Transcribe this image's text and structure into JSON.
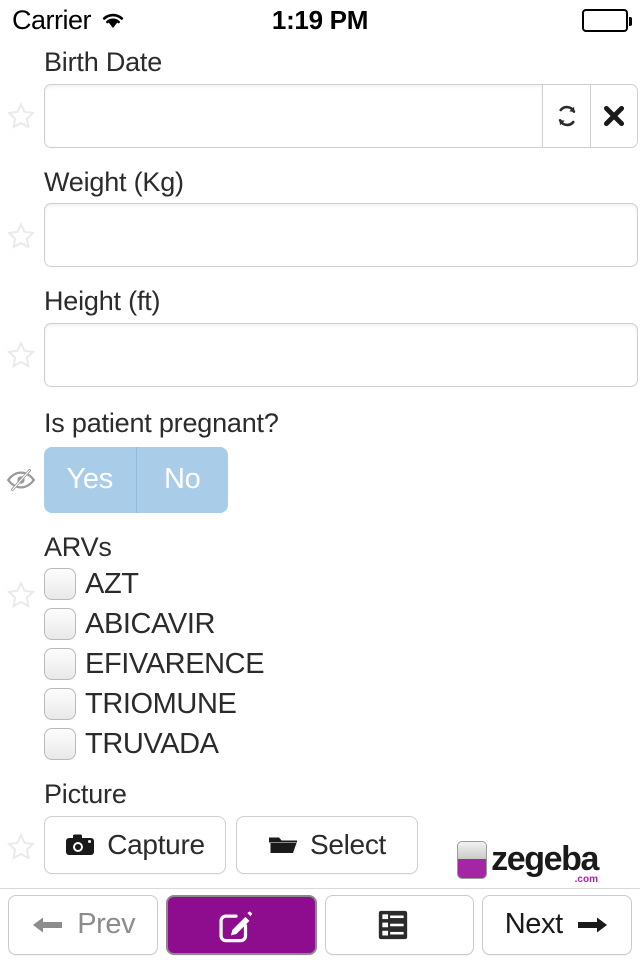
{
  "statusbar": {
    "carrier": "Carrier",
    "wifi_icon": "wifi-icon",
    "time": "1:19 PM",
    "battery_icon": "battery-full-icon"
  },
  "form": {
    "fields": [
      {
        "label": "Birth Date",
        "value": "",
        "gutter_icon": "star-icon",
        "type": "date-input-group",
        "buttons": [
          {
            "name": "refresh-icon",
            "label": ""
          },
          {
            "name": "clear-icon",
            "label": ""
          }
        ]
      },
      {
        "label": "Weight (Kg)",
        "value": "",
        "gutter_icon": "star-icon",
        "type": "text-input"
      },
      {
        "label": "Height (ft)",
        "value": "",
        "gutter_icon": "star-icon",
        "type": "text-input"
      },
      {
        "label": "Is patient pregnant?",
        "gutter_icon": "eye-slash-icon",
        "type": "segmented",
        "options": [
          {
            "label": "Yes",
            "selected": false
          },
          {
            "label": "No",
            "selected": false
          }
        ]
      },
      {
        "label": "ARVs",
        "gutter_icon": "star-icon",
        "type": "checkbox-list",
        "options": [
          {
            "label": "AZT",
            "checked": false
          },
          {
            "label": "ABICAVIR",
            "checked": false
          },
          {
            "label": "EFIVARENCE",
            "checked": false
          },
          {
            "label": "TRIOMUNE",
            "checked": false
          },
          {
            "label": "TRUVADA",
            "checked": false
          }
        ]
      },
      {
        "label": "Picture",
        "gutter_icon": "star-icon",
        "type": "picture-buttons",
        "buttons": [
          {
            "label": "Capture",
            "icon": "camera-icon"
          },
          {
            "label": "Select",
            "icon": "folder-icon"
          }
        ]
      }
    ]
  },
  "logo": {
    "text": "zegeba",
    "suffix": ".com",
    "mark_icon": "zegeba-mark-icon"
  },
  "bottom_nav": {
    "prev": {
      "label": "Prev",
      "icon": "arrow-left-icon",
      "enabled": false
    },
    "edit": {
      "label": "",
      "icon": "compose-icon",
      "active": true
    },
    "list": {
      "label": "",
      "icon": "list-icon",
      "active": false
    },
    "next": {
      "label": "Next",
      "icon": "arrow-right-icon",
      "enabled": true
    }
  },
  "colors": {
    "accent_purple": "#8e0c8e",
    "segment_blue": "#a9cde8",
    "border_gray": "#cfcfcf",
    "text_dark": "#2b2b2b",
    "text_dim": "#8c8c8c"
  }
}
